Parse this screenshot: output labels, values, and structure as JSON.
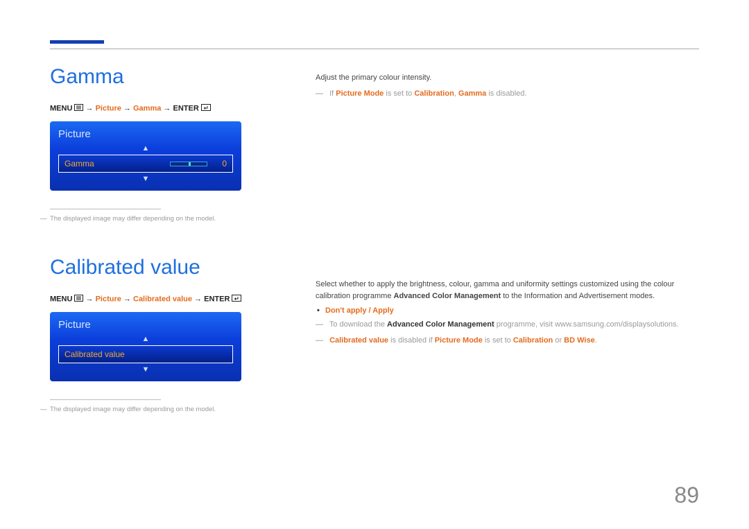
{
  "page_number": "89",
  "gamma": {
    "title": "Gamma",
    "path_menu": "MENU",
    "path_picture": "Picture",
    "path_gamma": "Gamma",
    "path_enter": "ENTER",
    "panel_title": "Picture",
    "row_label": "Gamma",
    "row_value": "0",
    "img_note": "The displayed image may differ depending on the model.",
    "desc": "Adjust the primary colour intensity.",
    "remark_pre": "If ",
    "remark_pm": "Picture Mode",
    "remark_mid": " is set to ",
    "remark_cal": "Calibration",
    "remark_sep": ", ",
    "remark_g": "Gamma",
    "remark_end": " is disabled."
  },
  "calib": {
    "title": "Calibrated value",
    "path_menu": "MENU",
    "path_picture": "Picture",
    "path_cv": "Calibrated value",
    "path_enter": "ENTER",
    "panel_title": "Picture",
    "row_label": "Calibrated value",
    "img_note": "The displayed image may differ depending on the model.",
    "desc1_pre": "Select whether to apply the brightness, colour, gamma and uniformity settings customized using the colour calibration programme ",
    "desc1_acm": "Advanced Color Management",
    "desc1_post": " to the Information and Advertisement modes.",
    "bullet": "Don't apply / Apply",
    "remark2_pre": "To download the ",
    "remark2_acm": "Advanced Color Management",
    "remark2_post": " programme, visit www.samsung.com/displaysolutions.",
    "remark3_cv": "Calibrated value",
    "remark3_mid1": " is disabled if ",
    "remark3_pm": "Picture Mode",
    "remark3_mid2": " is set to ",
    "remark3_cal": "Calibration",
    "remark3_or": " or ",
    "remark3_bd": "BD Wise",
    "remark3_end": "."
  }
}
